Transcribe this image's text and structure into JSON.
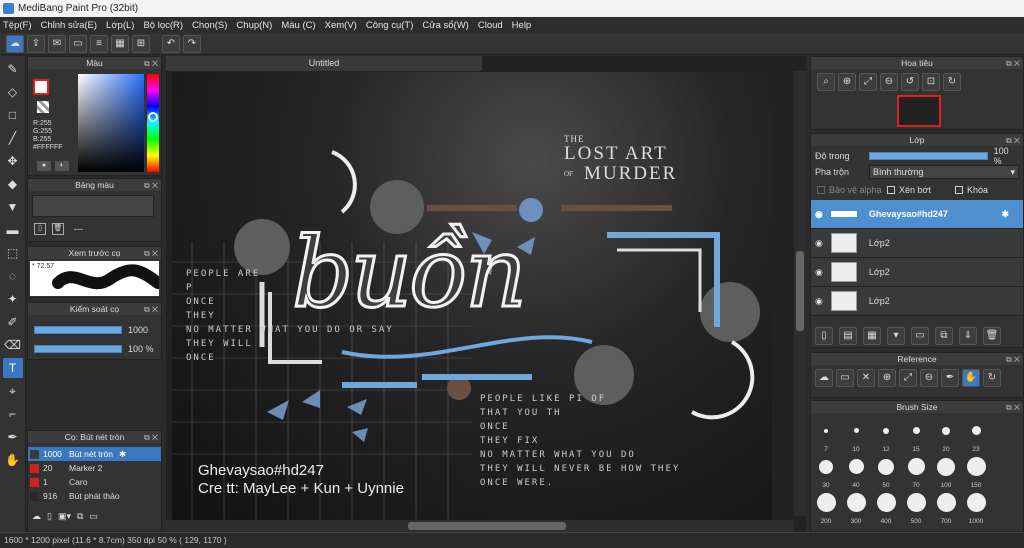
{
  "app": {
    "title": "MediBang Paint Pro (32bit)"
  },
  "menu": [
    "Tệp(F)",
    "Chỉnh sửa(E)",
    "Lớp(L)",
    "Bộ lọc(R)",
    "Chọn(S)",
    "Chụp(N)",
    "Màu (C)",
    "Xem(V)",
    "Công cụ(T)",
    "Cửa sổ(W)",
    "Cloud",
    "Help"
  ],
  "canvas": {
    "tab_label": "Untitled",
    "title1": "THE",
    "title2": "LOST ART",
    "title3": "OF",
    "title4": "MURDER",
    "big_word": "buồn",
    "caption1": "Ghevaysao#hd247",
    "caption2": "Cre tt: MayLee + Kun + Uynnie",
    "left_text": [
      "PEOPLE ARE",
      "P",
      "ONCE",
      "THEY",
      "NO MATTER WHAT YOU DO OR SAY",
      "THEY WILL",
      "ONCE"
    ],
    "right_text": [
      "PEOPLE LIKE PI   OF",
      "THAT YOU   TH",
      "ONCE",
      "THEY   FIX",
      "NO MATTER WHAT YOU DO",
      "THEY WILL NEVER BE HOW THEY",
      "ONCE   WERE."
    ]
  },
  "color_panel": {
    "title": "Màu",
    "r": "R:255",
    "g": "G:255",
    "b": "B:255",
    "hex": "#FFFFFF",
    "primary": "#e02020",
    "secondary": "#ffffff"
  },
  "palette_panel": {
    "title": "Bảng màu",
    "dash": "---"
  },
  "preview_panel": {
    "title": "Xem trước cọ",
    "size": "72.57"
  },
  "stroke_panel": {
    "title": "Kiểm soát cọ",
    "value1": "1000",
    "value2": "100 %",
    "level1_pct": 100,
    "level2_pct": 100
  },
  "brush_panel": {
    "title": "Cọ: Bút nét tròn",
    "items": [
      {
        "size": "1000",
        "name": "Bút nét tròn",
        "color": "#3a3a3a"
      },
      {
        "size": "20",
        "name": "Marker 2",
        "color": "#d02020"
      },
      {
        "size": "1",
        "name": "Caro",
        "color": "#d02020"
      },
      {
        "size": "916",
        "name": "Bút phát thảo",
        "color": "#2a2a2a"
      }
    ]
  },
  "navigator": {
    "title": "Hoa tiêu"
  },
  "layer_panel": {
    "title": "Lớp",
    "opacity_label": "Độ trong",
    "opacity_value": "100 %",
    "opacity_pct": 100,
    "blend_label": "Pha trộn",
    "blend_value": "Bình thường",
    "alpha_label": "Bảo vệ alpha",
    "clip_label": "Xén bớt",
    "lock_label": "Khóa",
    "layers": [
      {
        "name": "Ghevaysao#hd247",
        "selected": true
      },
      {
        "name": "Lớp2",
        "selected": false
      },
      {
        "name": "Lớp2",
        "selected": false
      },
      {
        "name": "Lớp2",
        "selected": false
      }
    ]
  },
  "reference_panel": {
    "title": "Reference"
  },
  "brush_size_panel": {
    "title": "Brush Size",
    "sizes": [
      "7",
      "10",
      "12",
      "15",
      "20",
      "23",
      "30",
      "40",
      "50",
      "70",
      "100",
      "150",
      "200",
      "300",
      "400",
      "500",
      "700",
      "1000"
    ]
  },
  "status": {
    "text": "1600 * 1200 pixel   (11.6 * 8.7cm)   350 dpi   50 %   ( 129, 1170 )"
  }
}
